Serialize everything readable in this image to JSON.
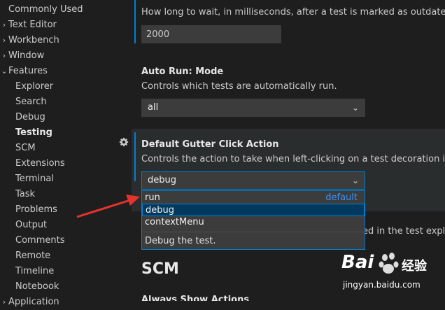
{
  "sidebar": {
    "items": [
      {
        "label": "Commonly Used",
        "level": 0,
        "expandable": false
      },
      {
        "label": "Text Editor",
        "level": 0,
        "expandable": true
      },
      {
        "label": "Workbench",
        "level": 0,
        "expandable": true
      },
      {
        "label": "Window",
        "level": 0,
        "expandable": true
      },
      {
        "label": "Features",
        "level": 0,
        "expandable": true,
        "expanded": true
      },
      {
        "label": "Explorer",
        "level": 1
      },
      {
        "label": "Search",
        "level": 1
      },
      {
        "label": "Debug",
        "level": 1
      },
      {
        "label": "Testing",
        "level": 1,
        "active": true
      },
      {
        "label": "SCM",
        "level": 1
      },
      {
        "label": "Extensions",
        "level": 1
      },
      {
        "label": "Terminal",
        "level": 1
      },
      {
        "label": "Task",
        "level": 1
      },
      {
        "label": "Problems",
        "level": 1
      },
      {
        "label": "Output",
        "level": 1
      },
      {
        "label": "Comments",
        "level": 1
      },
      {
        "label": "Remote",
        "level": 1
      },
      {
        "label": "Timeline",
        "level": 1
      },
      {
        "label": "Notebook",
        "level": 1
      },
      {
        "label": "Application",
        "level": 0,
        "expandable": true
      }
    ]
  },
  "settings": {
    "outdated": {
      "description": "How long to wait, in milliseconds, after a test is marked as outdated and starting a new run.",
      "value": "2000"
    },
    "auto_run": {
      "category": "Auto Run: ",
      "name": "Mode",
      "description": "Controls which tests are automatically run.",
      "value": "all"
    },
    "gutter": {
      "name": "Default Gutter Click Action",
      "description": "Controls the action to take when left-clicking on a test decoration in the gutter.",
      "value": "debug",
      "options": [
        {
          "label": "run",
          "tag": "default"
        },
        {
          "label": "debug",
          "tag": ""
        },
        {
          "label": "contextMenu",
          "tag": ""
        }
      ],
      "selected_description": "Debug the test."
    },
    "hidden_desc_tail": "ed in the test explorer",
    "scm_heading": "SCM",
    "next_title": "Always Show Actions"
  },
  "watermark": {
    "brand": "Bai",
    "brand_suffix": "经验",
    "url": "jingyan.baidu.com"
  },
  "colors": {
    "accent": "#007fd4",
    "link": "#3794ff",
    "arrow": "#e5322d"
  },
  "icons": {
    "gear": "gear-icon",
    "chevron": "chevron-down-icon"
  }
}
